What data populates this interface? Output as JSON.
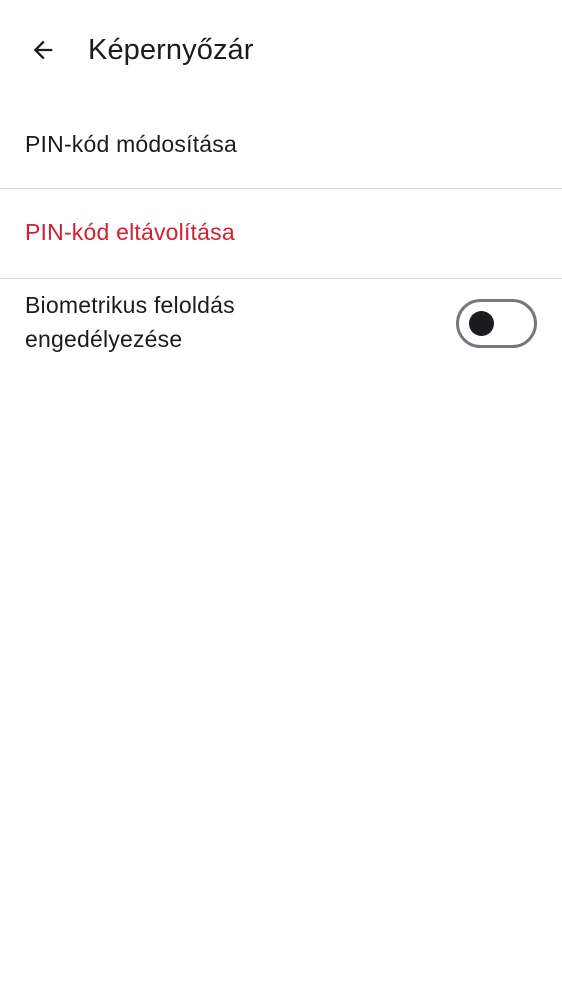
{
  "app_bar": {
    "back_icon": "arrow-back-icon",
    "title": "Képernyőzár"
  },
  "settings": {
    "change_pin_label": "PIN-kód módosítása",
    "remove_pin_label": "PIN-kód eltávolítása",
    "biometric_label": "Biometrikus feloldás engedélyezése",
    "biometric_enabled": false
  },
  "colors": {
    "text_primary": "#1c1b1f",
    "destructive": "#d32030",
    "divider": "#dadada",
    "switch_outline": "#79747e"
  }
}
